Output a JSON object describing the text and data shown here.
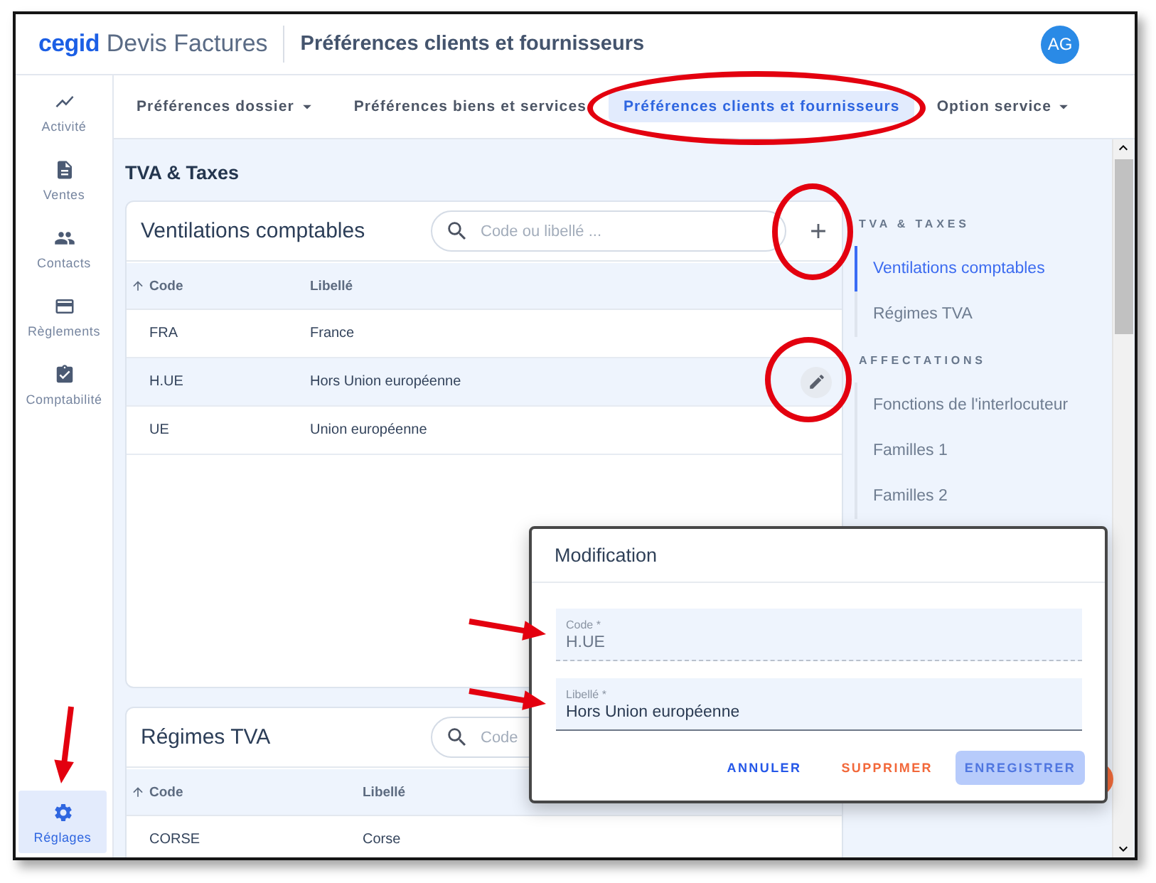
{
  "header": {
    "logo": "cegid",
    "app_name": "Devis Factures",
    "page_title": "Préférences clients et fournisseurs",
    "avatar": "AG"
  },
  "sidebar": {
    "items": [
      {
        "label": "Activité",
        "selected": false,
        "arrow": false
      },
      {
        "label": "Ventes",
        "selected": false,
        "arrow": false
      },
      {
        "label": "Contacts",
        "selected": false,
        "arrow": false
      },
      {
        "label": "Règlements",
        "selected": false,
        "arrow": false
      },
      {
        "label": "Comptabilité",
        "selected": false,
        "arrow": false
      }
    ],
    "bottom_items": [
      {
        "label": "Réglages",
        "selected": true,
        "arrow": true
      }
    ]
  },
  "tabs": [
    {
      "label": "Préférences dossier",
      "dropdown": true,
      "selected": false,
      "circled": false
    },
    {
      "label": "Préférences biens et services",
      "dropdown": false,
      "selected": false,
      "circled": false
    },
    {
      "label": "Préférences clients et fournisseurs",
      "dropdown": false,
      "selected": true,
      "circled": true
    },
    {
      "label": "Option service",
      "dropdown": true,
      "selected": false,
      "circled": false
    }
  ],
  "section_title": "TVA & Taxes",
  "cards": [
    {
      "title": "Ventilations comptables",
      "search": {
        "placeholder": "Code ou libellé ..."
      },
      "add_button": {
        "circled": true
      },
      "columns": [
        {
          "label": "Code",
          "sorted": true
        },
        {
          "label": "Libellé",
          "sorted": false
        }
      ],
      "rows": [
        {
          "cells": [
            "FRA",
            "France"
          ],
          "selected": false,
          "circled": false
        },
        {
          "cells": [
            "H.UE",
            "Hors Union européenne"
          ],
          "selected": true,
          "circled": true
        },
        {
          "cells": [
            "UE",
            "Union européenne"
          ],
          "selected": false,
          "circled": false
        }
      ]
    },
    {
      "title": "Régimes TVA",
      "search": {
        "placeholder": "Code"
      },
      "columns": [
        {
          "label": "Code",
          "sorted": true
        },
        {
          "label": "Libellé",
          "sorted": false
        }
      ],
      "rows": [
        {
          "cells": [
            "CORSE",
            "Corse"
          ],
          "selected": false,
          "circled": false
        }
      ]
    }
  ],
  "right_nav": {
    "sections": [
      {
        "label": "TVA & TAXES",
        "items": [
          {
            "label": "Ventilations comptables",
            "selected": true
          },
          {
            "label": "Régimes TVA",
            "selected": false
          }
        ]
      },
      {
        "label": "AFFECTATIONS",
        "items": [
          {
            "label": "Fonctions de l'interlocuteur",
            "selected": false
          },
          {
            "label": "Familles 1",
            "selected": false
          },
          {
            "label": "Familles 2",
            "selected": false
          }
        ]
      }
    ]
  },
  "dialog": {
    "title": "Modification",
    "fields": [
      {
        "label": "Code *",
        "value": "H.UE",
        "disabled": true,
        "arrow": true
      },
      {
        "label": "Libellé *",
        "value": "Hors Union européenne",
        "disabled": false,
        "arrow": true
      }
    ],
    "buttons": [
      {
        "label": "ANNULER",
        "kind": "cancel",
        "disabled": false
      },
      {
        "label": "SUPPRIMER",
        "kind": "delete",
        "disabled": false
      },
      {
        "label": "ENREGISTRER",
        "kind": "save",
        "disabled": true
      }
    ]
  }
}
